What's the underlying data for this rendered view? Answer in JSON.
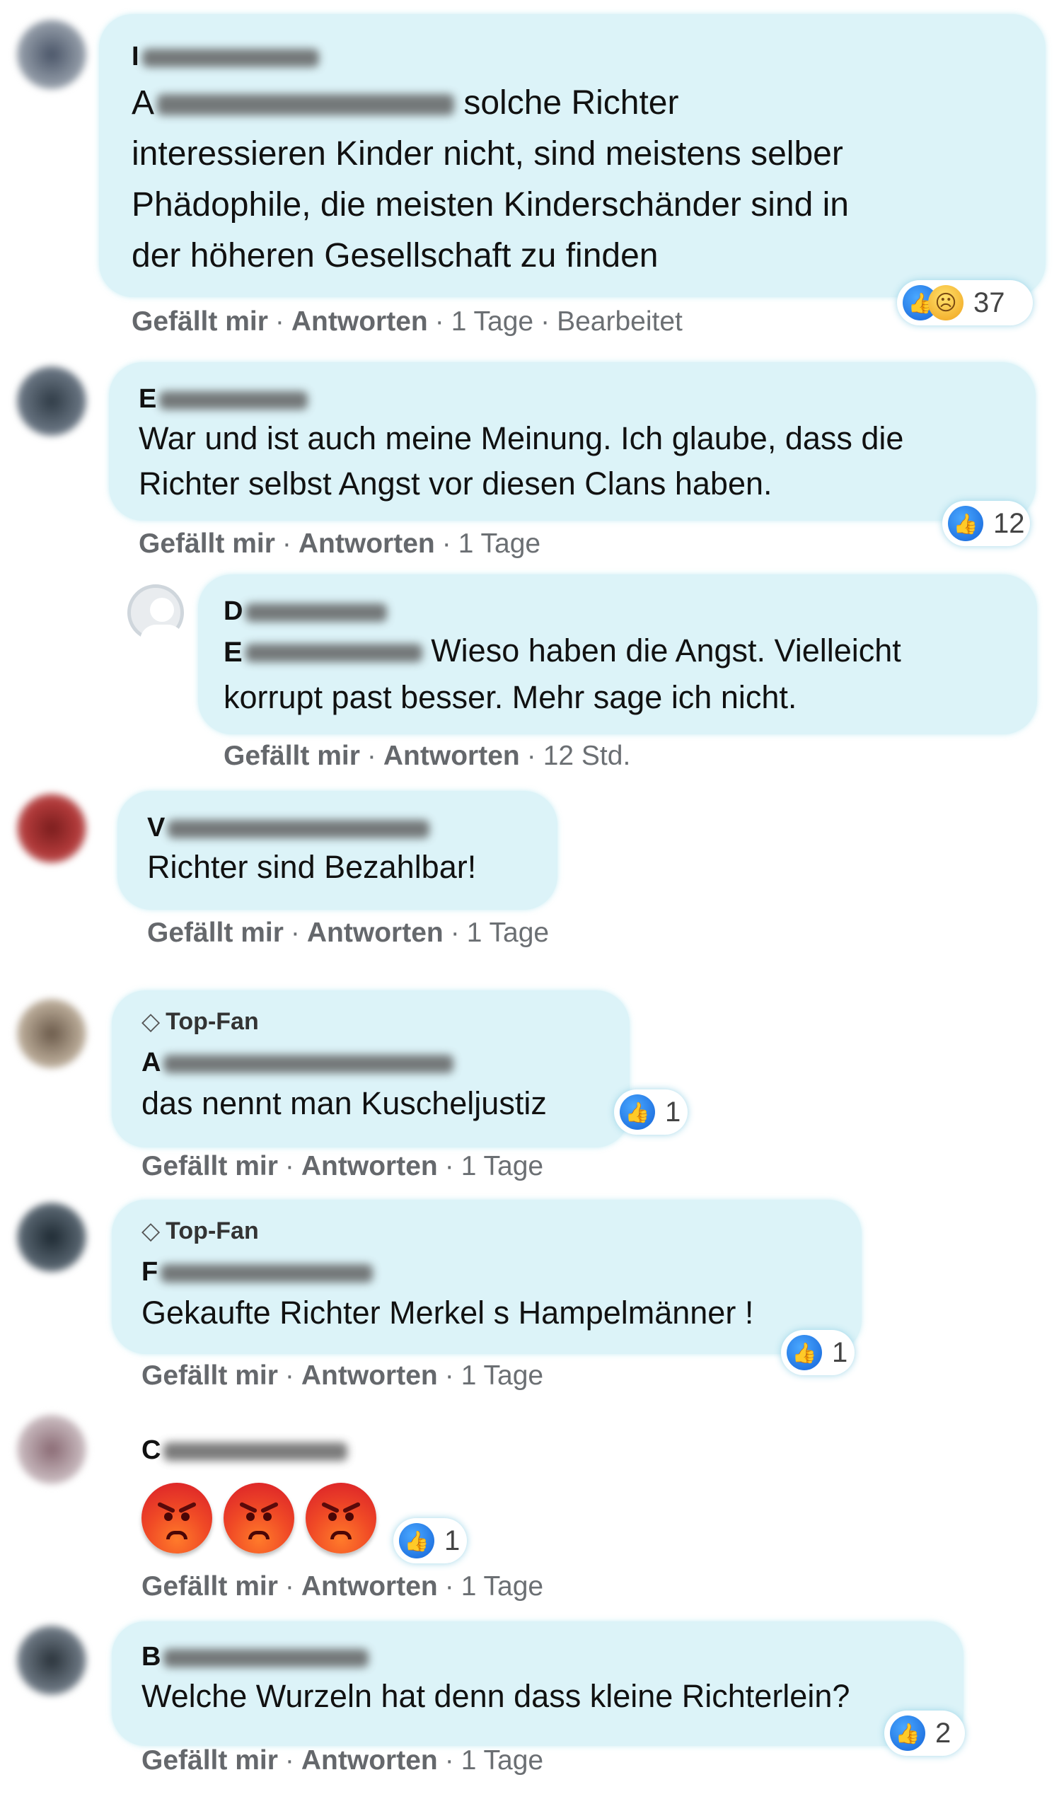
{
  "comments": [
    {
      "name_visible": "I",
      "text_prefix_visible": "A",
      "text": "solche Richter interessieren Kinder nicht, sind meistens selber Phädophile, die meisten Kinderschänder sind in der höheren Gesellschaft zu finden",
      "line1": "solche Richter",
      "line2": "interessieren Kinder nicht, sind meistens selber",
      "line3": "Phädophile, die meisten Kinderschänder sind in",
      "line4": "der höheren Gesellschaft zu finden",
      "reactions": [
        "like-icon",
        "sad-icon"
      ],
      "reaction_count": "37",
      "like": "Gefällt mir",
      "reply": "Antworten",
      "time": "1 Tage",
      "edited": "Bearbeitet"
    },
    {
      "name_visible": "E",
      "line1": "War und ist auch meine Meinung. Ich glaube, dass die",
      "line2": "Richter selbst Angst vor diesen Clans haben.",
      "reactions": [
        "like-icon"
      ],
      "reaction_count": "12",
      "like": "Gefällt mir",
      "reply": "Antworten",
      "time": "1 Tage"
    },
    {
      "name_visible": "D",
      "mention_visible": "E",
      "line1": "Wieso haben die Angst. Vielleicht",
      "line2": "korrupt past besser. Mehr sage ich nicht.",
      "like": "Gefällt mir",
      "reply": "Antworten",
      "time": "12 Std."
    },
    {
      "name_visible": "V",
      "line1": "Richter sind Bezahlbar!",
      "like": "Gefällt mir",
      "reply": "Antworten",
      "time": "1 Tage"
    },
    {
      "badge": "Top-Fan",
      "name_visible": "A",
      "line1": "das nennt man Kuscheljustiz",
      "reactions": [
        "like-icon"
      ],
      "reaction_count": "1",
      "like": "Gefällt mir",
      "reply": "Antworten",
      "time": "1 Tage"
    },
    {
      "badge": "Top-Fan",
      "name_visible": "F",
      "line1": "Gekaufte Richter Merkel s Hampelmänner !",
      "reactions": [
        "like-icon"
      ],
      "reaction_count": "1",
      "like": "Gefällt mir",
      "reply": "Antworten",
      "time": "1 Tage"
    },
    {
      "name_visible": "C",
      "emojis": [
        "angry-face",
        "angry-face",
        "angry-face"
      ],
      "reactions": [
        "like-icon"
      ],
      "reaction_count": "1",
      "like": "Gefällt mir",
      "reply": "Antworten",
      "time": "1 Tage"
    },
    {
      "name_visible": "B",
      "line1": "Welche Wurzeln hat denn dass kleine Richterlein?",
      "reactions": [
        "like-icon"
      ],
      "reaction_count": "2",
      "like": "Gefällt mir",
      "reply": "Antworten",
      "time": "1 Tage"
    }
  ],
  "colors": {
    "bubble": "#dcf3f8",
    "meta_text": "#65686c",
    "like_blue": "#1877f2",
    "background": "#ffffff"
  }
}
